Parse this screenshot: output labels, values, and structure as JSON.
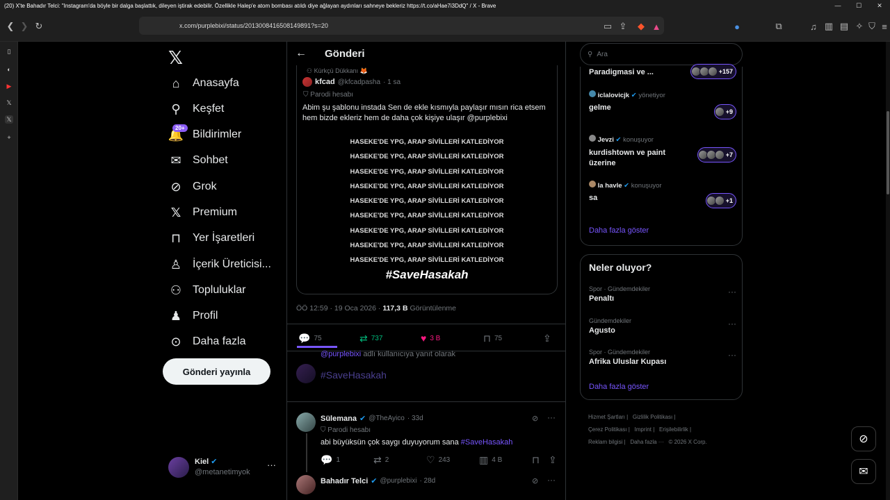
{
  "window": {
    "title": "(20) X'te Bahadır Telci: \"Instagram'da böyle bir dalga başlattık, dileyen iştirak edebilir. Özellikle Halep'e atom bombası atıldı diye ağlayan aydınları sahneye bekleriz https://t.co/aHae7i3DdQ\" / X - Brave",
    "url": "x.com/purplebixi/status/2013008416508149891?s=20"
  },
  "nav": {
    "items": [
      {
        "label": "Anasayfa",
        "icon": "home-icon"
      },
      {
        "label": "Keşfet",
        "icon": "search-icon"
      },
      {
        "label": "Bildirimler",
        "icon": "bell-icon",
        "badge": "20+"
      },
      {
        "label": "Sohbet",
        "icon": "mail-icon"
      },
      {
        "label": "Grok",
        "icon": "grok-icon"
      },
      {
        "label": "Premium",
        "icon": "x-icon"
      },
      {
        "label": "Yer İşaretleri",
        "icon": "bookmark-icon"
      },
      {
        "label": "İçerik Üreticisi...",
        "icon": "creator-icon"
      },
      {
        "label": "Topluluklar",
        "icon": "people-icon"
      },
      {
        "label": "Profil",
        "icon": "person-icon"
      },
      {
        "label": "Daha fazla",
        "icon": "more-icon"
      }
    ],
    "post_button": "Gönderi yayınla",
    "account": {
      "name": "Kiel",
      "handle": "@metanetimyok"
    }
  },
  "main": {
    "header_title": "Gönderi",
    "quote": {
      "community": "Kürkçü Dükkanı 🦊",
      "name": "kfcad",
      "handle": "@kfcadpasha",
      "time": "· 1 sa",
      "parody": "Parodi hesabı",
      "text": "Abim şu şablonu instada Sen de ekle kısmıyla paylaşır mısın rica etsem hem bizde ekleriz hem de daha çok kişiye ulaşır @purplebixi",
      "image_lines": [
        "HASEKE'DE YPG, ARAP SİVİLLERİ KATLEDİYOR",
        "HASEKE'DE YPG, ARAP SİVİLLERİ KATLEDİYOR",
        "HASEKE'DE YPG, ARAP SİVİLLERİ KATLEDİYOR",
        "HASEKE'DE YPG, ARAP SİVİLLERİ KATLEDİYOR",
        "HASEKE'DE YPG, ARAP SİVİLLERİ KATLEDİYOR",
        "HASEKE'DE YPG, ARAP SİVİLLERİ KATLEDİYOR",
        "HASEKE'DE YPG, ARAP SİVİLLERİ KATLEDİYOR",
        "HASEKE'DE YPG, ARAP SİVİLLERİ KATLEDİYOR",
        "HASEKE'DE YPG, ARAP SİVİLLERİ KATLEDİYOR"
      ],
      "image_tag": "#SaveHasakah"
    },
    "meta": {
      "time": "ÖÖ 12:59 · 19 Oca 2026 ·",
      "views": "117,3 B",
      "views_label": "Görüntülenme"
    },
    "actions": {
      "replies": "75",
      "reposts": "737",
      "likes": "3 B",
      "bookmarks": "75"
    },
    "reply_to": {
      "handle": "@purplebixi",
      "suffix": "adlı kullanıcıya yanıt olarak"
    },
    "composer_hashtag": "#SaveHasakah",
    "replies": [
      {
        "name": "Sülemana",
        "handle": "@TheAyico",
        "time": "· 33d",
        "parody": "Parodi hesabı",
        "text": "abi büyüksün çok saygı duyuyorum sana",
        "tag": "#SaveHasakah",
        "replies": "1",
        "reposts": "2",
        "likes": "243",
        "views": "4 B"
      },
      {
        "name": "Bahadır Telci",
        "handle": "@purplebixi",
        "time": "· 28d"
      }
    ]
  },
  "right": {
    "search_placeholder": "Ara",
    "spaces": [
      {
        "host": "",
        "status": "",
        "title": "Paradigmasi ve ...",
        "count": "+157"
      },
      {
        "host": "iclalovicjk",
        "status": "yönetiyor",
        "title": "gelme",
        "count": "+9"
      },
      {
        "host": "Jevzi",
        "status": "konuşuyor",
        "title": "kurdishtown ve paint üzerine",
        "count": "+7"
      },
      {
        "host": "la havle",
        "status": "konuşuyor",
        "title": "sa",
        "count": "+1"
      }
    ],
    "spaces_more": "Daha fazla göster",
    "trends_title": "Neler oluyor?",
    "trends": [
      {
        "category": "Spor · Gündemdekiler",
        "name": "Penaltı"
      },
      {
        "category": "Gündemdekiler",
        "name": "Agusto"
      },
      {
        "category": "Spor · Gündemdekiler",
        "name": "Afrika Uluslar Kupası"
      }
    ],
    "trends_more": "Daha fazla göster",
    "footer": [
      "Hizmet Şartları",
      "Gizlilik Politikası",
      "Çerez Politikası",
      "Imprint",
      "Erişilebilirlik",
      "Reklam bilgisi",
      "Daha fazla ···",
      "© 2026 X Corp."
    ]
  }
}
